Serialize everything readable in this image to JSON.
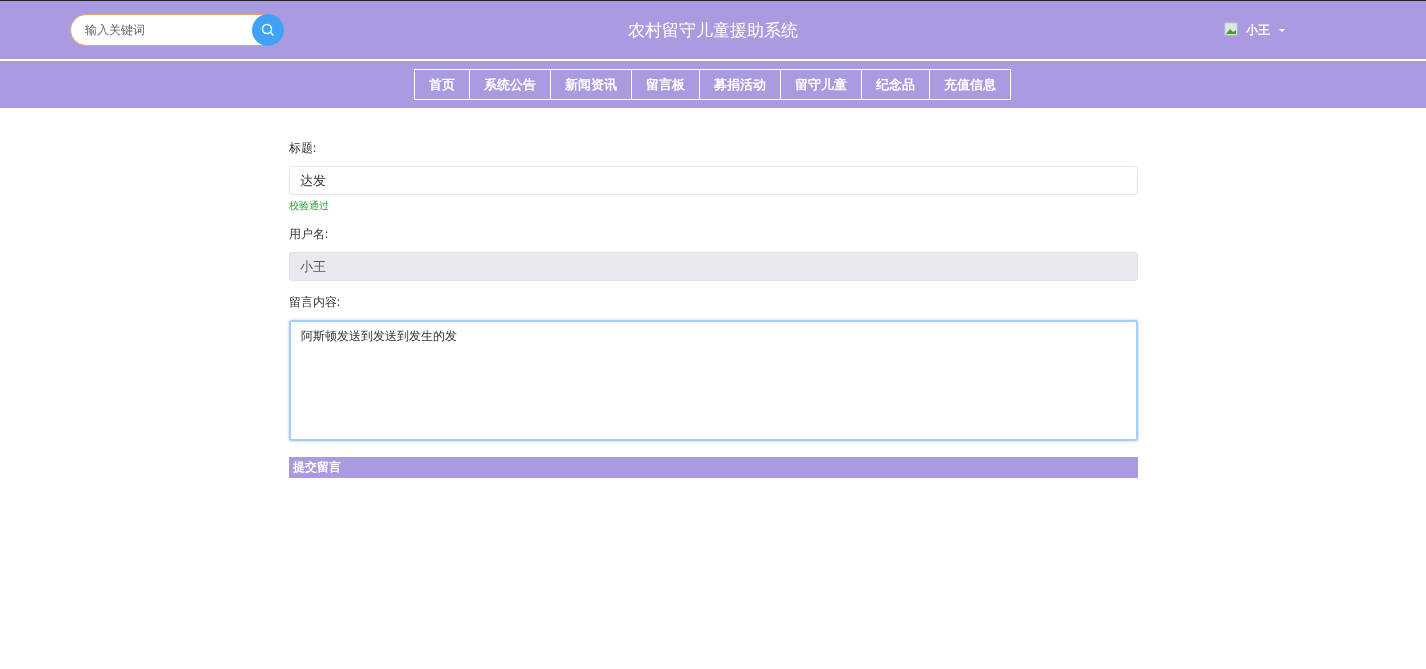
{
  "header": {
    "search": {
      "placeholder": "输入关键词"
    },
    "title": "农村留守儿童援助系统",
    "user": {
      "name": "小王"
    }
  },
  "nav": [
    {
      "label": "首页"
    },
    {
      "label": "系统公告"
    },
    {
      "label": "新闻资讯"
    },
    {
      "label": "留言板"
    },
    {
      "label": "募捐活动"
    },
    {
      "label": "留守儿童"
    },
    {
      "label": "纪念品"
    },
    {
      "label": "充值信息"
    }
  ],
  "form": {
    "fields": [
      {
        "kind": "input",
        "label": "标题:",
        "value": "达发",
        "disabled": false,
        "hint": "校验通过"
      },
      {
        "kind": "input",
        "label": "用户名:",
        "value": "小王",
        "disabled": true
      },
      {
        "kind": "textarea",
        "label": "留言内容:",
        "value": "阿斯顿发送到发送到发生的发",
        "focused": true
      }
    ],
    "submit": "提交留言"
  }
}
